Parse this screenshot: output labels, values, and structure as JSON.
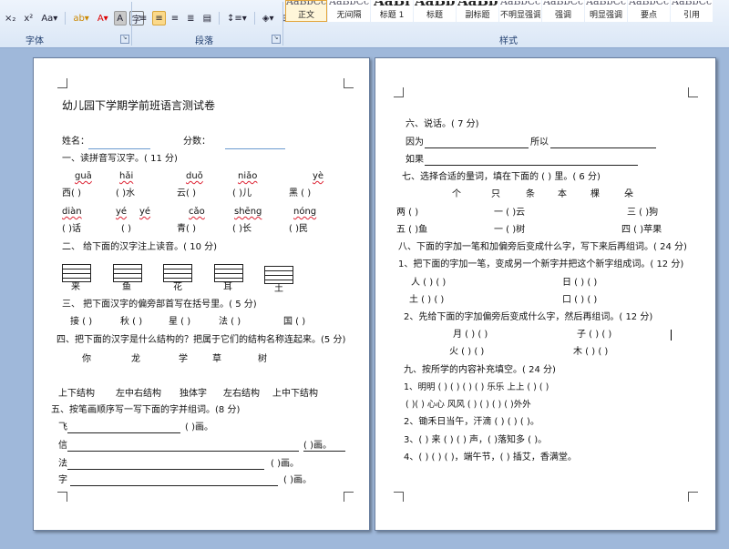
{
  "ribbon": {
    "font_row1": [
      "×₂",
      "x²",
      "Aa▾"
    ],
    "font_row_icons": [
      "highlight-icon",
      "font-color-icon",
      "char-shade-icon",
      "enclose-icon"
    ],
    "font_row_text": {
      "font_color": "A",
      "char_shade": "A",
      "enclose": "字"
    },
    "para_row": [
      "align-left",
      "align-center",
      "align-right",
      "justify",
      "distributed",
      "line-spacing",
      "shading",
      "borders"
    ],
    "groups": {
      "font": "字体",
      "paragraph": "段落",
      "styles": "样式"
    },
    "styles": [
      {
        "preview": "AaBbCcDd",
        "name": "正文",
        "big": false,
        "selected": true
      },
      {
        "preview": "AaBbCcDd",
        "name": "无间隔",
        "big": false,
        "selected": false
      },
      {
        "preview": "AaBl",
        "name": "标题 1",
        "big": true,
        "selected": false
      },
      {
        "preview": "AaBbC",
        "name": "标题",
        "big": true,
        "selected": false
      },
      {
        "preview": "AaBbC",
        "name": "副标题",
        "big": true,
        "selected": false
      },
      {
        "preview": "AaBbCcDd",
        "name": "不明显强调",
        "big": false,
        "selected": false
      },
      {
        "preview": "AaBbCcDd",
        "name": "强调",
        "big": false,
        "selected": false
      },
      {
        "preview": "AaBbCcDd",
        "name": "明显强调",
        "big": false,
        "selected": false
      },
      {
        "preview": "AaBbCcD",
        "name": "要点",
        "big": false,
        "selected": false
      },
      {
        "preview": "AaBbCcDd",
        "name": "引用",
        "big": false,
        "selected": false
      }
    ]
  },
  "page1": {
    "title": "幼儿园下学期学前班语言测试卷",
    "name_label": "姓名：",
    "score_label": "分数：",
    "q1": "一、读拼音写汉字。( 11 分)",
    "q1_pinyin_row1": [
      "guā",
      "hǎi",
      "duǒ",
      "niǎo",
      "yè"
    ],
    "q1_hanzi_row1": [
      "西(     )",
      "(       )水",
      "云(     )",
      "(       )儿",
      "黑 (     )"
    ],
    "q1_pinyin_row2": [
      "diàn",
      "yé",
      "yé",
      "cǎo",
      "shēng",
      "nóng"
    ],
    "q1_hanzi_row2": [
      "(     )话",
      "(          )",
      "青(      )",
      "(       )长",
      "(     )民"
    ],
    "q2": "二、 给下面的汉字注上读音。(  10 分)",
    "q2_chars": [
      "来",
      "鱼",
      "花",
      "耳",
      "土"
    ],
    "q3": "三、  把下面汉字的偏旁部首写在括号里。(  5 分)",
    "q3_items": [
      "接 (     )",
      "秋 (     )",
      "星 (     )",
      "法 (        )",
      "国 (     )"
    ],
    "q4": "四、把下面的汉字是什么结构的？把属于它们的结构名称连起来。(5 分)",
    "q4_chars": [
      "你",
      "龙",
      "学",
      "草",
      "树"
    ],
    "q4_structs": [
      "上下结构",
      "左中右结构",
      "独体字",
      "左右结构",
      "上中下结构"
    ],
    "q5": "五、按笔画顺序写一写下面的字并组词。(8 分)",
    "q5_items": [
      {
        "ch": "飞",
        "tail": "(   )画。"
      },
      {
        "ch": "信",
        "tail": "(   )画。"
      },
      {
        "ch": "法",
        "tail": "(    )画。"
      },
      {
        "ch": "字",
        "tail": "(      )画。"
      }
    ]
  },
  "page2": {
    "q6": "六、说话。( 7 分)",
    "q6_l1a": "因为",
    "q6_l1b": "所以",
    "q6_l2": "如果",
    "q7": "七、选择合适的量词，填在下面的 ( ) 里。( 6 分)",
    "q7_words": [
      "个",
      "只",
      "条",
      "本",
      "棵",
      "朵"
    ],
    "q7_row1": [
      "两 (     )",
      "一 (     )云",
      "三 (     )狗"
    ],
    "q7_row2": [
      "五 (     )鱼",
      "一 (     )树",
      "四 (     )苹果"
    ],
    "q8": "八、下面的字加一笔和加偏旁后变成什么字，写下来后再组词。(   24 分)",
    "q8_1": "1、把下面的字加一笔，变成另一个新字并把这个新字组成词。( 12 分)",
    "q8_1_row1": [
      "人 (     ) (          )",
      "日 (     ) (          )"
    ],
    "q8_1_row2": [
      "土 (     ) (          )",
      "口 (     ) (          )"
    ],
    "q8_2": "2、先给下面的字加偏旁后变成什么字，然后再组词。( 12 分)",
    "q8_2_row1": [
      "月 (     ) (          )",
      "子 (     ) (          )"
    ],
    "q8_2_row2": [
      "火 (     ) (          )",
      "木 (     ) (          )"
    ],
    "q9": "九、按所学的内容补充填空。( 24 分)",
    "q9_l1": "1、明明 (     ) (     )  (     ) (     ) 乐乐      上上 (     ) (     )",
    "q9_l2": "(   )(    ) 心心          风风 (     ) (     )       (     ) (   )外外",
    "q9_l3": "2、锄禾日当午，汗滴 (   ) (   ) (   )。",
    "q9_l4": "3、(   ) 来 (   ) (   ) 声，(     )落知多 (   )。",
    "q9_l5": "4、(   ) (   ) (   )，端午节，(   ) 插艾，香满堂。"
  }
}
